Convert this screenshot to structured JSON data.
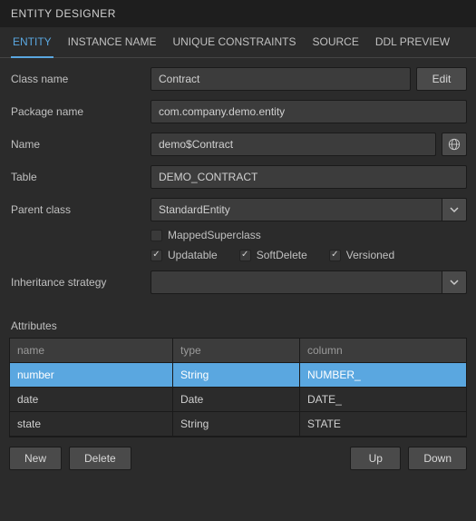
{
  "header": {
    "title": "ENTITY DESIGNER"
  },
  "tabs": [
    {
      "id": "entity",
      "label": "ENTITY",
      "active": true
    },
    {
      "id": "instance",
      "label": "INSTANCE NAME"
    },
    {
      "id": "unique",
      "label": "UNIQUE CONSTRAINTS"
    },
    {
      "id": "source",
      "label": "SOURCE"
    },
    {
      "id": "ddl",
      "label": "DDL PREVIEW"
    }
  ],
  "form": {
    "className": {
      "label": "Class name",
      "value": "Contract",
      "editLabel": "Edit"
    },
    "packageName": {
      "label": "Package name",
      "value": "com.company.demo.entity"
    },
    "name": {
      "label": "Name",
      "value": "demo$Contract"
    },
    "table": {
      "label": "Table",
      "value": "DEMO_CONTRACT"
    },
    "parentClass": {
      "label": "Parent class",
      "value": "StandardEntity"
    },
    "checks": {
      "mapped": {
        "label": "MappedSuperclass",
        "checked": false
      },
      "updatable": {
        "label": "Updatable",
        "checked": true
      },
      "softDelete": {
        "label": "SoftDelete",
        "checked": true
      },
      "versioned": {
        "label": "Versioned",
        "checked": true
      }
    },
    "inheritance": {
      "label": "Inheritance strategy",
      "value": ""
    }
  },
  "attributes": {
    "title": "Attributes",
    "headers": {
      "name": "name",
      "type": "type",
      "column": "column"
    },
    "rows": [
      {
        "name": "number",
        "type": "String",
        "column": "NUMBER_",
        "selected": true
      },
      {
        "name": "date",
        "type": "Date",
        "column": "DATE_"
      },
      {
        "name": "state",
        "type": "String",
        "column": "STATE"
      }
    ]
  },
  "footer": {
    "new": "New",
    "delete": "Delete",
    "up": "Up",
    "down": "Down"
  }
}
